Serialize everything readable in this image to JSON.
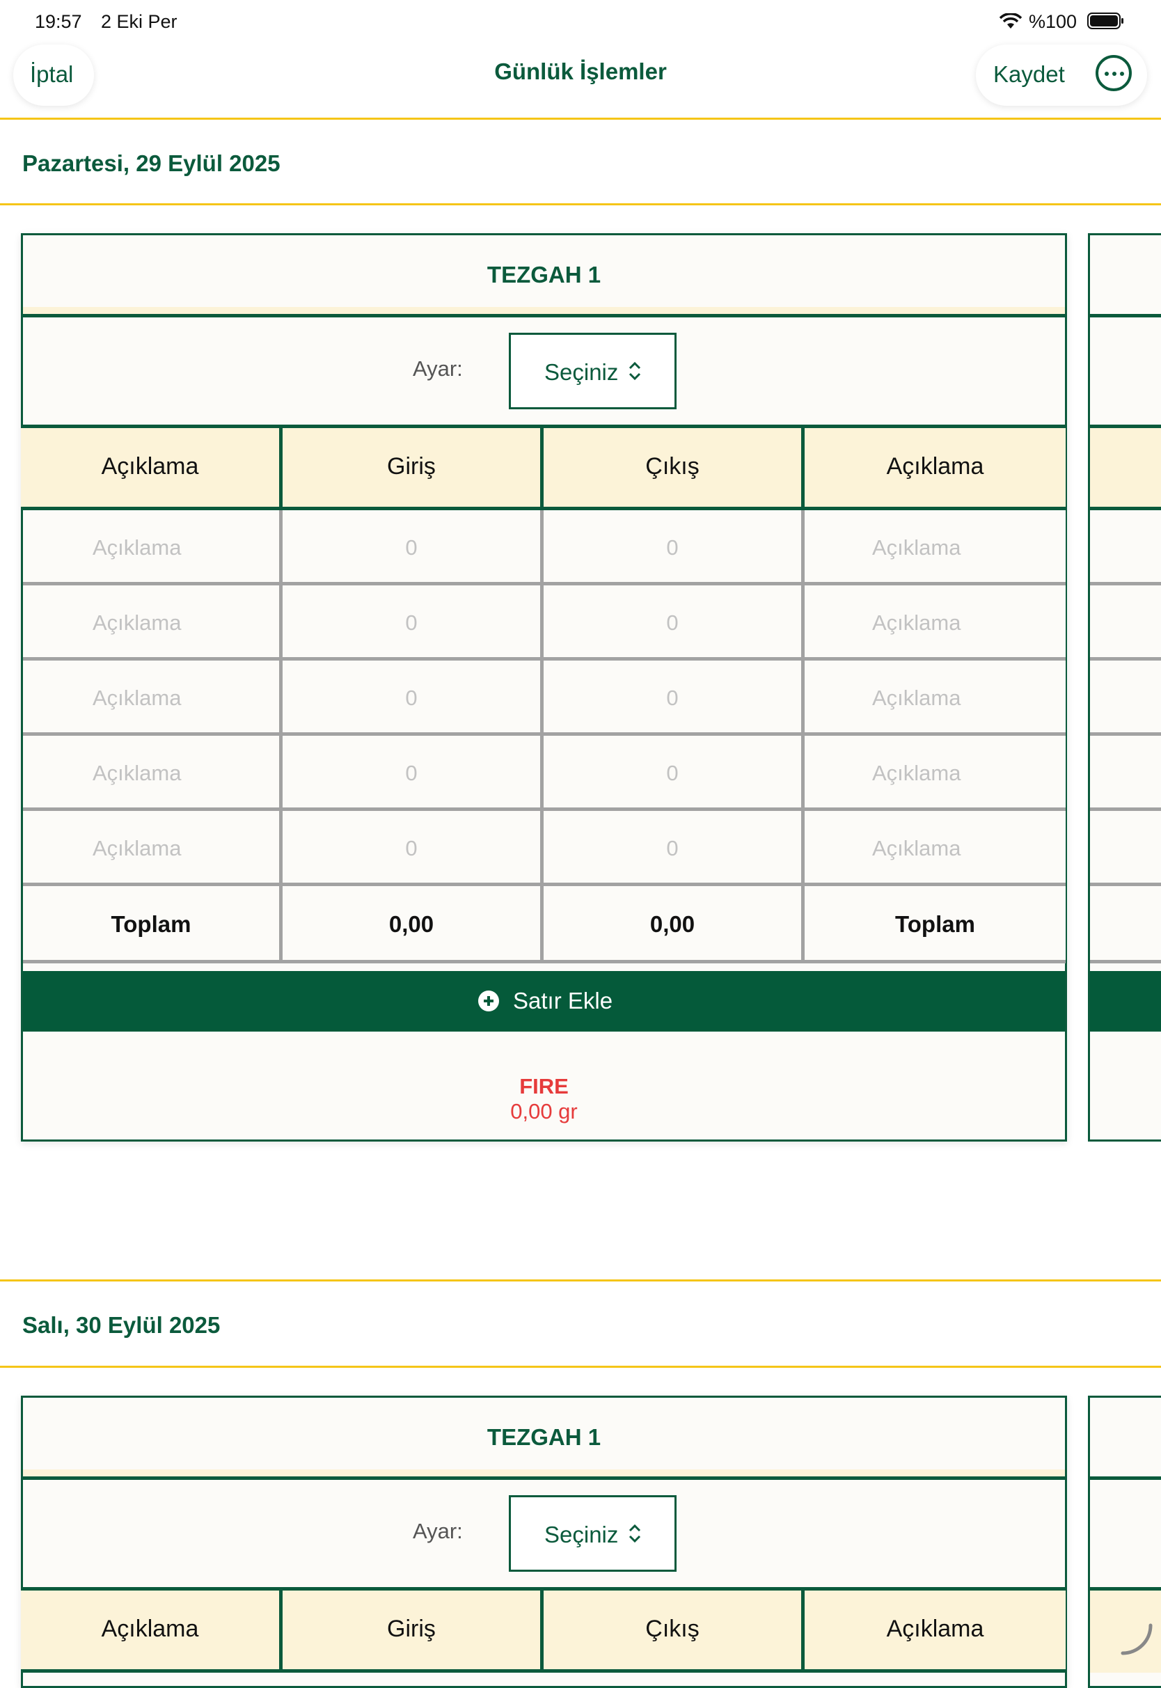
{
  "status_bar": {
    "time": "19:57",
    "date": "2 Eki Per",
    "battery": "%100"
  },
  "nav": {
    "cancel": "İptal",
    "title": "Günlük İşlemler",
    "save": "Kaydet"
  },
  "days": [
    {
      "date": "Pazartesi, 29 Eylül 2025",
      "card": {
        "title": "TEZGAH 1",
        "ayar_label": "Ayar:",
        "ayar_value": "Seçiniz",
        "columns": [
          "Açıklama",
          "Giriş",
          "Çıkış",
          "Açıklama"
        ],
        "rows": [
          [
            "Açıklama",
            "0",
            "0",
            "Açıklama"
          ],
          [
            "Açıklama",
            "0",
            "0",
            "Açıklama"
          ],
          [
            "Açıklama",
            "0",
            "0",
            "Açıklama"
          ],
          [
            "Açıklama",
            "0",
            "0",
            "Açıklama"
          ],
          [
            "Açıklama",
            "0",
            "0",
            "Açıklama"
          ]
        ],
        "totals": [
          "Toplam",
          "0,00",
          "0,00",
          "Toplam"
        ],
        "add_row": "Satır Ekle",
        "fire_label": "FIRE",
        "fire_value": "0,00 gr"
      }
    },
    {
      "date": "Salı, 30 Eylül 2025",
      "card": {
        "title": "TEZGAH 1",
        "ayar_label": "Ayar:",
        "ayar_value": "Seçiniz",
        "columns": [
          "Açıklama",
          "Giriş",
          "Çıkış",
          "Açıklama"
        ]
      }
    }
  ],
  "colors": {
    "primary_green": "#0b5a3c",
    "button_green": "#055a3a",
    "accent_yellow": "#f5c518",
    "header_cream": "#fcf3d8",
    "fire_red": "#e63b3b"
  },
  "icons": [
    "wifi-icon",
    "battery-icon",
    "more-icon",
    "chevron-updown-icon",
    "plus-circle-icon",
    "spinner-icon"
  ]
}
